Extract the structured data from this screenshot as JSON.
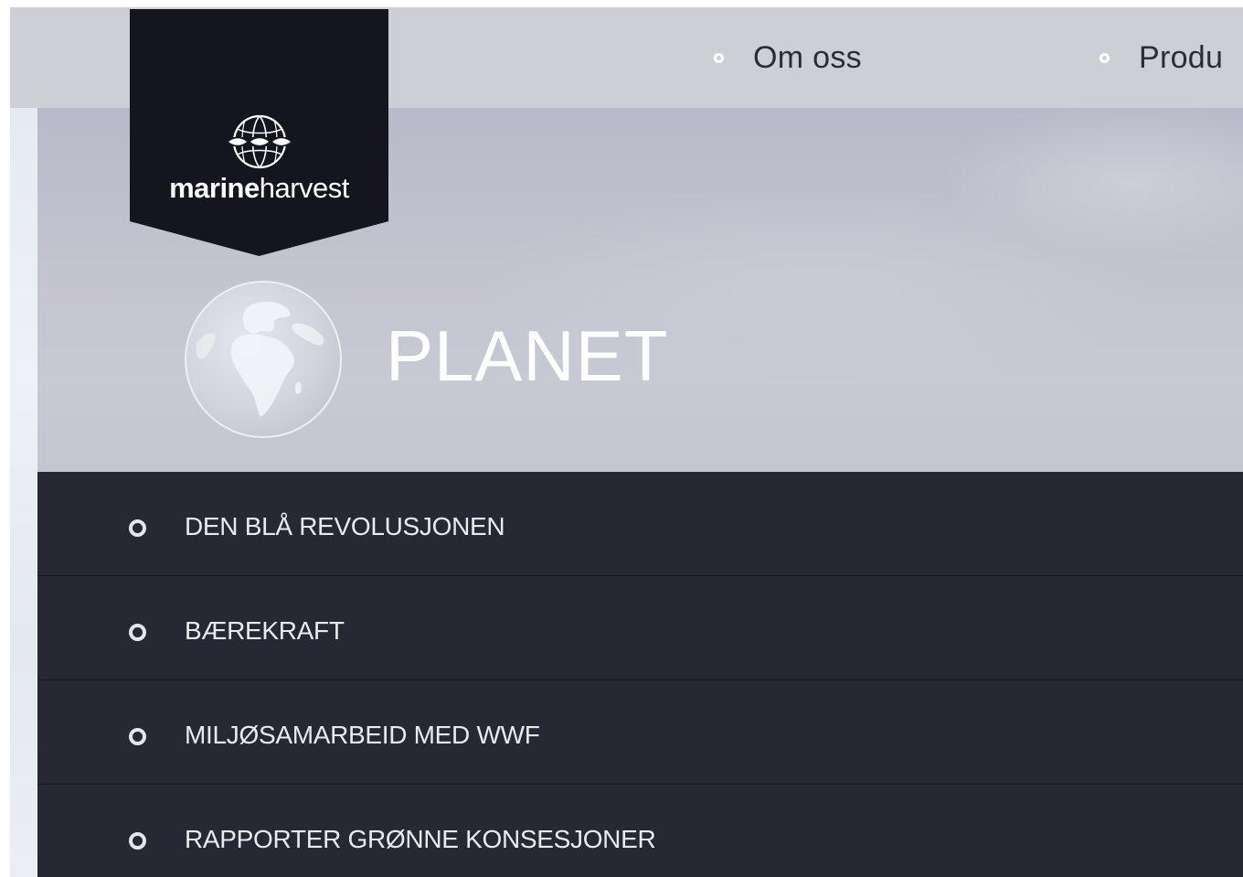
{
  "header": {
    "nav": [
      {
        "label": "Om oss"
      },
      {
        "label": "Produ"
      }
    ]
  },
  "logo": {
    "word_bold": "marine",
    "word_regular": "harvest"
  },
  "hero": {
    "title": "PLANET",
    "icon": "globe-icon"
  },
  "submenu": {
    "items": [
      {
        "label": "DEN BLÅ REVOLUSJONEN"
      },
      {
        "label": "BÆREKRAFT"
      },
      {
        "label": "MILJØSAMARBEID MED WWF"
      },
      {
        "label": "RAPPORTER GRØNNE KONSESJONER"
      }
    ]
  },
  "colors": {
    "topbar": "#cdcfd4",
    "logo_badge": "#14151f",
    "submenu_bg": "#272834",
    "text_light": "#ffffff",
    "nav_text": "#2a2c38"
  }
}
